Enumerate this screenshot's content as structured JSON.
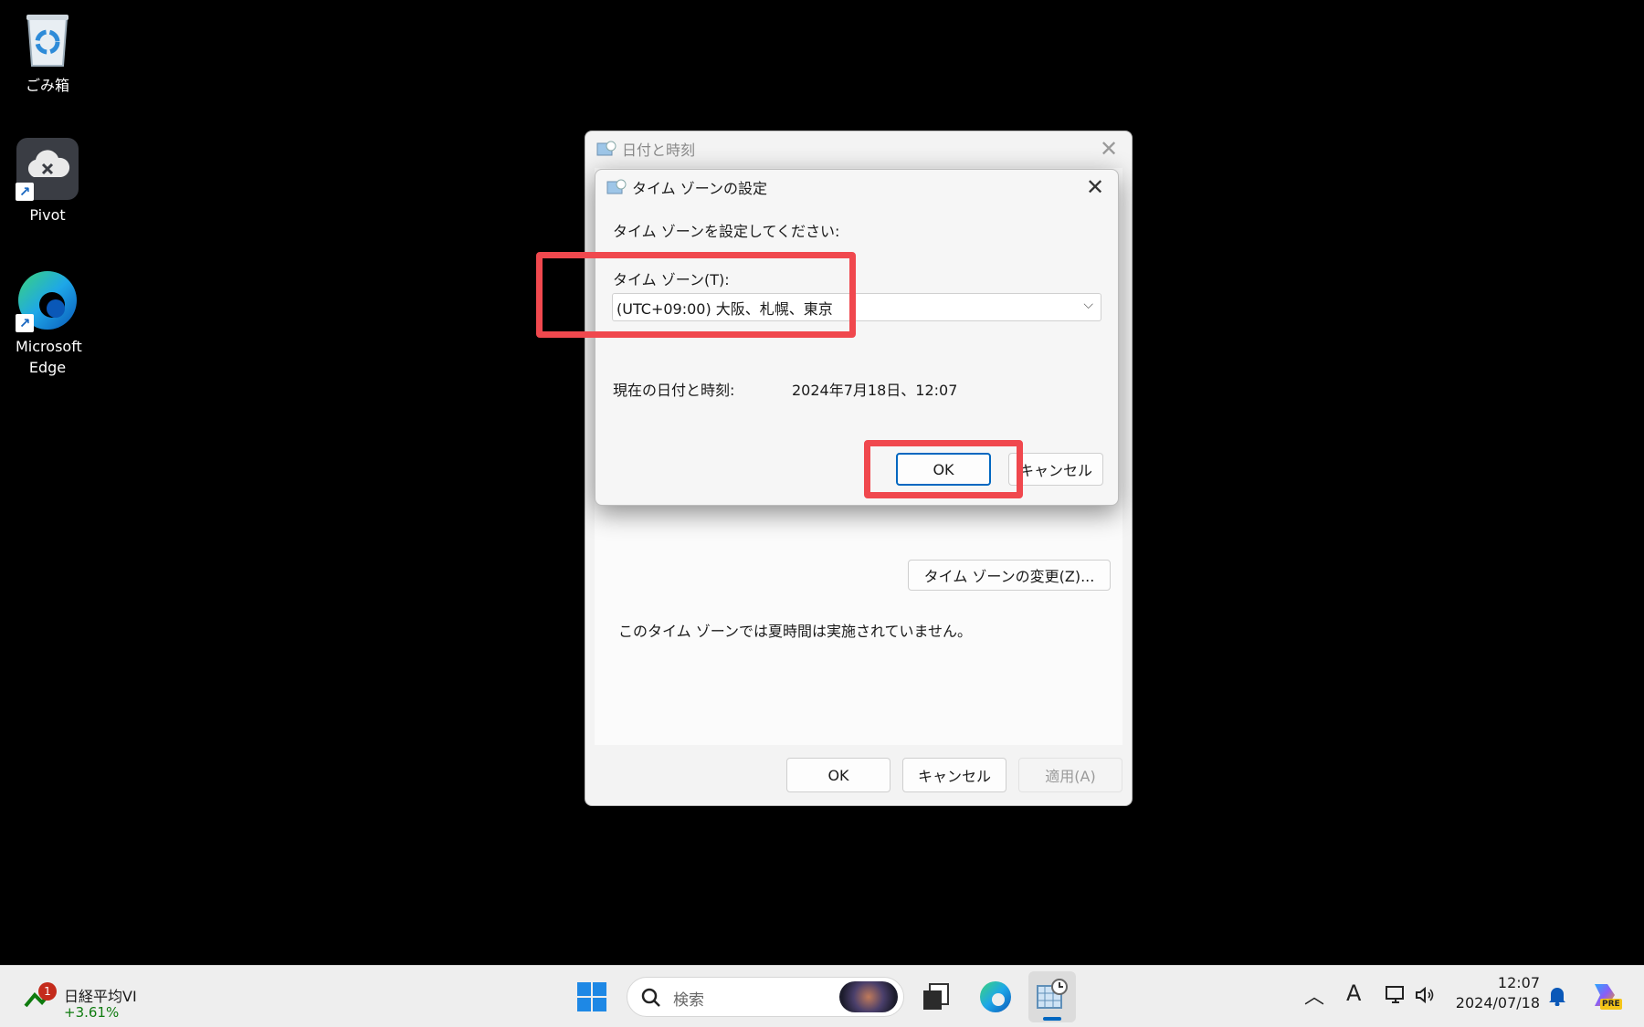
{
  "desktop": {
    "icons": [
      {
        "label": "ごみ箱"
      },
      {
        "label": "Pivot"
      },
      {
        "label": "Microsoft Edge"
      }
    ]
  },
  "outer_dialog": {
    "title": "日付と時刻",
    "change_tz_button": "タイム ゾーンの変更(Z)...",
    "dst_note": "このタイム ゾーンでは夏時間は実施されていません。",
    "ok_label": "OK",
    "cancel_label": "キャンセル",
    "apply_label": "適用(A)"
  },
  "tz_dialog": {
    "title": "タイム ゾーンの設定",
    "instruction": "タイム ゾーンを設定してください:",
    "tz_label": "タイム ゾーン(T):",
    "tz_value": "(UTC+09:00) 大阪、札幌、東京",
    "current_label": "現在の日付と時刻:",
    "current_value": "2024年7月18日、12:07",
    "ok_label": "OK",
    "cancel_label": "キャンセル"
  },
  "taskbar": {
    "widget_title": "日経平均VI",
    "widget_change": "+3.61%",
    "widget_badge": "1",
    "search_placeholder": "検索",
    "ime_indicator": "A",
    "clock_time": "12:07",
    "clock_date": "2024/07/18",
    "copilot_badge": "PRE"
  },
  "colors": {
    "highlight": "#f0484e",
    "accent": "#0067c0",
    "positive": "#0f7b0f"
  }
}
